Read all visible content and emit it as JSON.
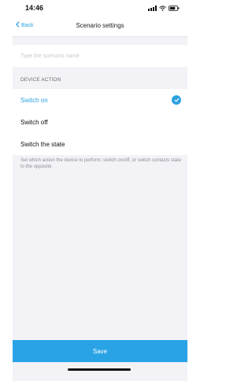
{
  "status_bar": {
    "time": "14:46"
  },
  "nav": {
    "back_label": "Back",
    "title": "Scenario settings"
  },
  "name_input": {
    "placeholder": "Type the scenario name",
    "value": ""
  },
  "device_action": {
    "section_label": "DEVICE ACTION",
    "options": [
      {
        "label": "Switch on",
        "selected": true
      },
      {
        "label": "Switch off",
        "selected": false
      },
      {
        "label": "Switch the state",
        "selected": false
      }
    ],
    "hint": "Set which action the device to perform: switch on/off, or switch contacts state to the opposite."
  },
  "footer": {
    "save_label": "Save"
  },
  "colors": {
    "accent": "#2ba1e0",
    "background": "#f2f2f7",
    "save_button": "#29a3e6"
  }
}
